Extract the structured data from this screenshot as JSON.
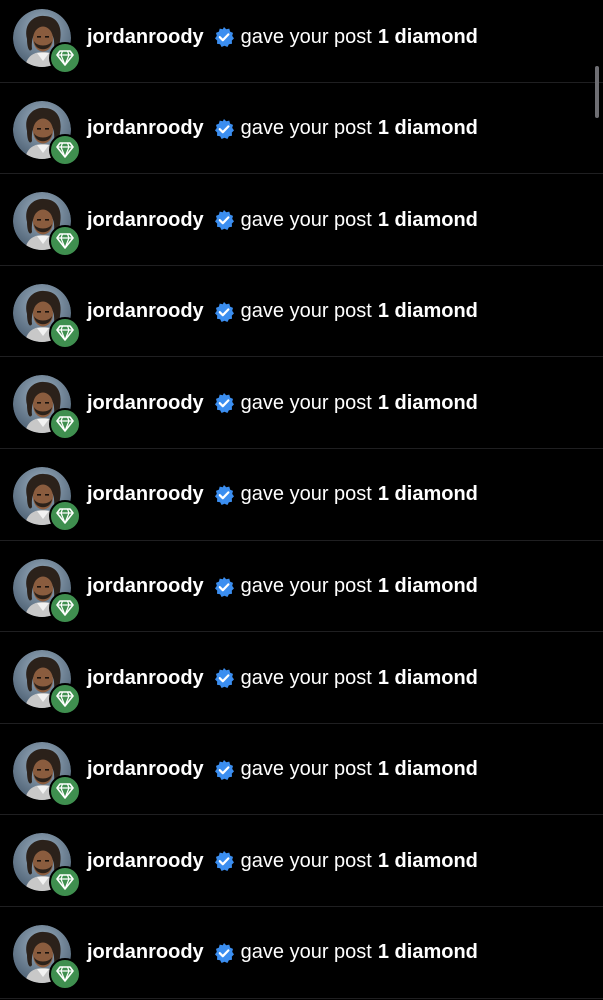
{
  "colors": {
    "background": "#000000",
    "verified_blue": "#3b8ef0",
    "diamond_badge_green": "#3f8f4f"
  },
  "icons": {
    "badge": "diamond-icon",
    "verified": "verified-check-icon"
  },
  "notifications": [
    {
      "username": "jordanroody",
      "action": "gave your post",
      "count_text": "1 diamond"
    },
    {
      "username": "jordanroody",
      "action": "gave your post",
      "count_text": "1 diamond"
    },
    {
      "username": "jordanroody",
      "action": "gave your post",
      "count_text": "1 diamond"
    },
    {
      "username": "jordanroody",
      "action": "gave your post",
      "count_text": "1 diamond"
    },
    {
      "username": "jordanroody",
      "action": "gave your post",
      "count_text": "1 diamond"
    },
    {
      "username": "jordanroody",
      "action": "gave your post",
      "count_text": "1 diamond"
    },
    {
      "username": "jordanroody",
      "action": "gave your post",
      "count_text": "1 diamond"
    },
    {
      "username": "jordanroody",
      "action": "gave your post",
      "count_text": "1 diamond"
    },
    {
      "username": "jordanroody",
      "action": "gave your post",
      "count_text": "1 diamond"
    },
    {
      "username": "jordanroody",
      "action": "gave your post",
      "count_text": "1 diamond"
    },
    {
      "username": "jordanroody",
      "action": "gave your post",
      "count_text": "1 diamond"
    }
  ]
}
